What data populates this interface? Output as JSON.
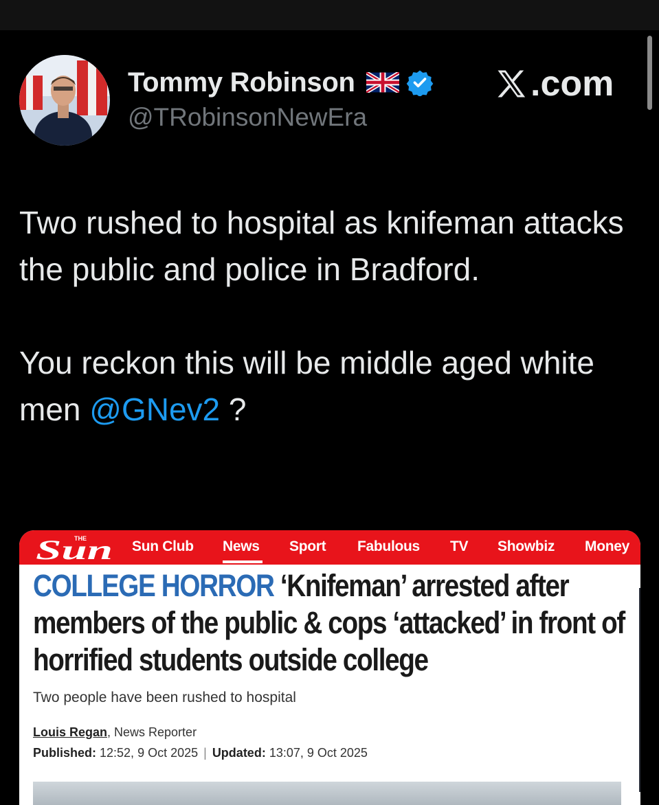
{
  "author": {
    "name": "Tommy Robinson",
    "handle": "@TRobinsonNewEra",
    "flag_icon": "uk-flag-icon",
    "verified_icon": "verified-badge-icon"
  },
  "brand": {
    "text": ".com",
    "icon": "x-logo-icon"
  },
  "tweet": {
    "line1": "Two rushed to hospital as knifeman attacks the public and police in Bradford.",
    "line2_before": "You reckon this will be middle aged white men ",
    "mention": "@GNev2",
    "line2_after": " ?"
  },
  "article": {
    "logo_top": "THE",
    "logo_text": "Sun",
    "nav": [
      "Sun Club",
      "News",
      "Sport",
      "Fabulous",
      "TV",
      "Showbiz",
      "Money"
    ],
    "active_nav": "News",
    "kicker": "COLLEGE HORROR",
    "headline": " ‘Knifeman’ arrested after members of the public & cops ‘attacked’ in front of horrified students outside college",
    "standfirst": "Two people have been rushed to hospital",
    "author": "Louis Regan",
    "author_role": ", News Reporter",
    "published_label": "Published:",
    "published": " 12:52, 9 Oct 2025",
    "separator": "|",
    "updated_label": "Updated:",
    "updated": " 13:07, 9 Oct 2025"
  },
  "colors": {
    "background": "#000000",
    "text": "#e7e9ea",
    "handle": "#71767b",
    "mention": "#1d9bf0",
    "sun_red": "#e8141b",
    "kicker_blue": "#2b6bb5"
  }
}
